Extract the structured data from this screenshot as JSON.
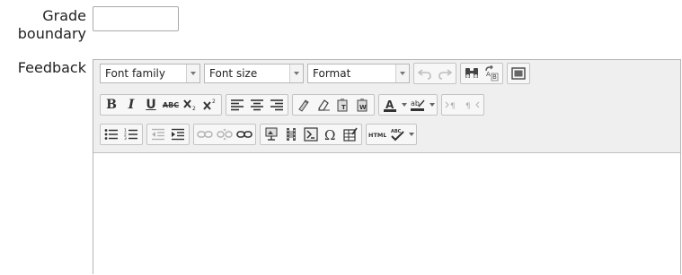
{
  "form": {
    "grade_boundary_label": "Grade boundary",
    "grade_boundary_value": "",
    "feedback_label": "Feedback"
  },
  "editor": {
    "font_family": "Font family",
    "font_size": "Font size",
    "format": "Format",
    "content": "",
    "toolbar_row1": [
      "undo-icon",
      "redo-icon",
      "find-icon",
      "find-replace-icon",
      "fullscreen-icon"
    ],
    "toolbar_row2": [
      "bold-icon",
      "italic-icon",
      "underline-icon",
      "strikethrough-icon",
      "subscript-icon",
      "superscript-icon",
      "align-left-icon",
      "align-center-icon",
      "align-right-icon",
      "cleanup-icon",
      "remove-format-icon",
      "paste-text-icon",
      "paste-word-icon",
      "text-color-icon",
      "background-color-icon",
      "ltr-icon",
      "rtl-icon"
    ],
    "toolbar_row3": [
      "bullet-list-icon",
      "numbered-list-icon",
      "outdent-icon",
      "indent-icon",
      "link-icon",
      "unlink-icon",
      "anchor-icon",
      "image-icon",
      "media-icon",
      "equation-icon",
      "special-char-icon",
      "table-icon",
      "html-source-icon",
      "spellcheck-icon"
    ]
  }
}
